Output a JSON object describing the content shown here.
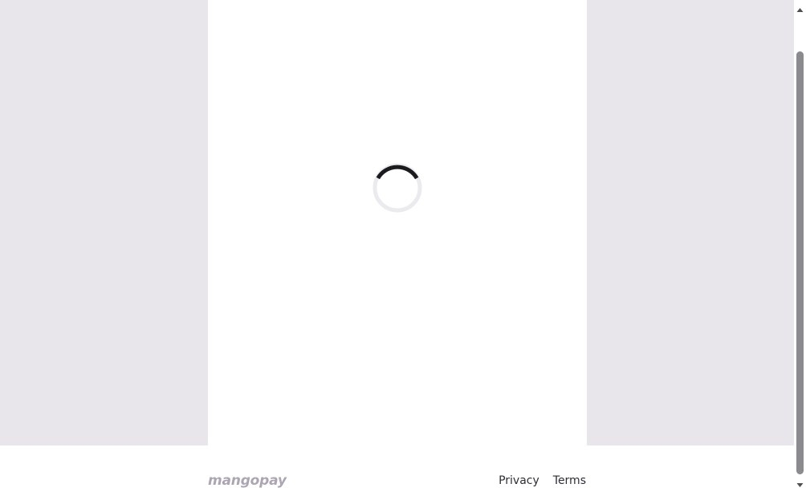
{
  "logo": {
    "text": "mangopay"
  },
  "footer": {
    "links": [
      {
        "label": "Privacy"
      },
      {
        "label": "Terms"
      }
    ]
  },
  "loader": {
    "icon": "spinner-icon"
  },
  "colors": {
    "backdrop": "#e8e6ea",
    "panel": "#ffffff",
    "logo": "#aca5b2",
    "link": "#2f2d35",
    "scroll_thumb": "#8b8b8f"
  }
}
